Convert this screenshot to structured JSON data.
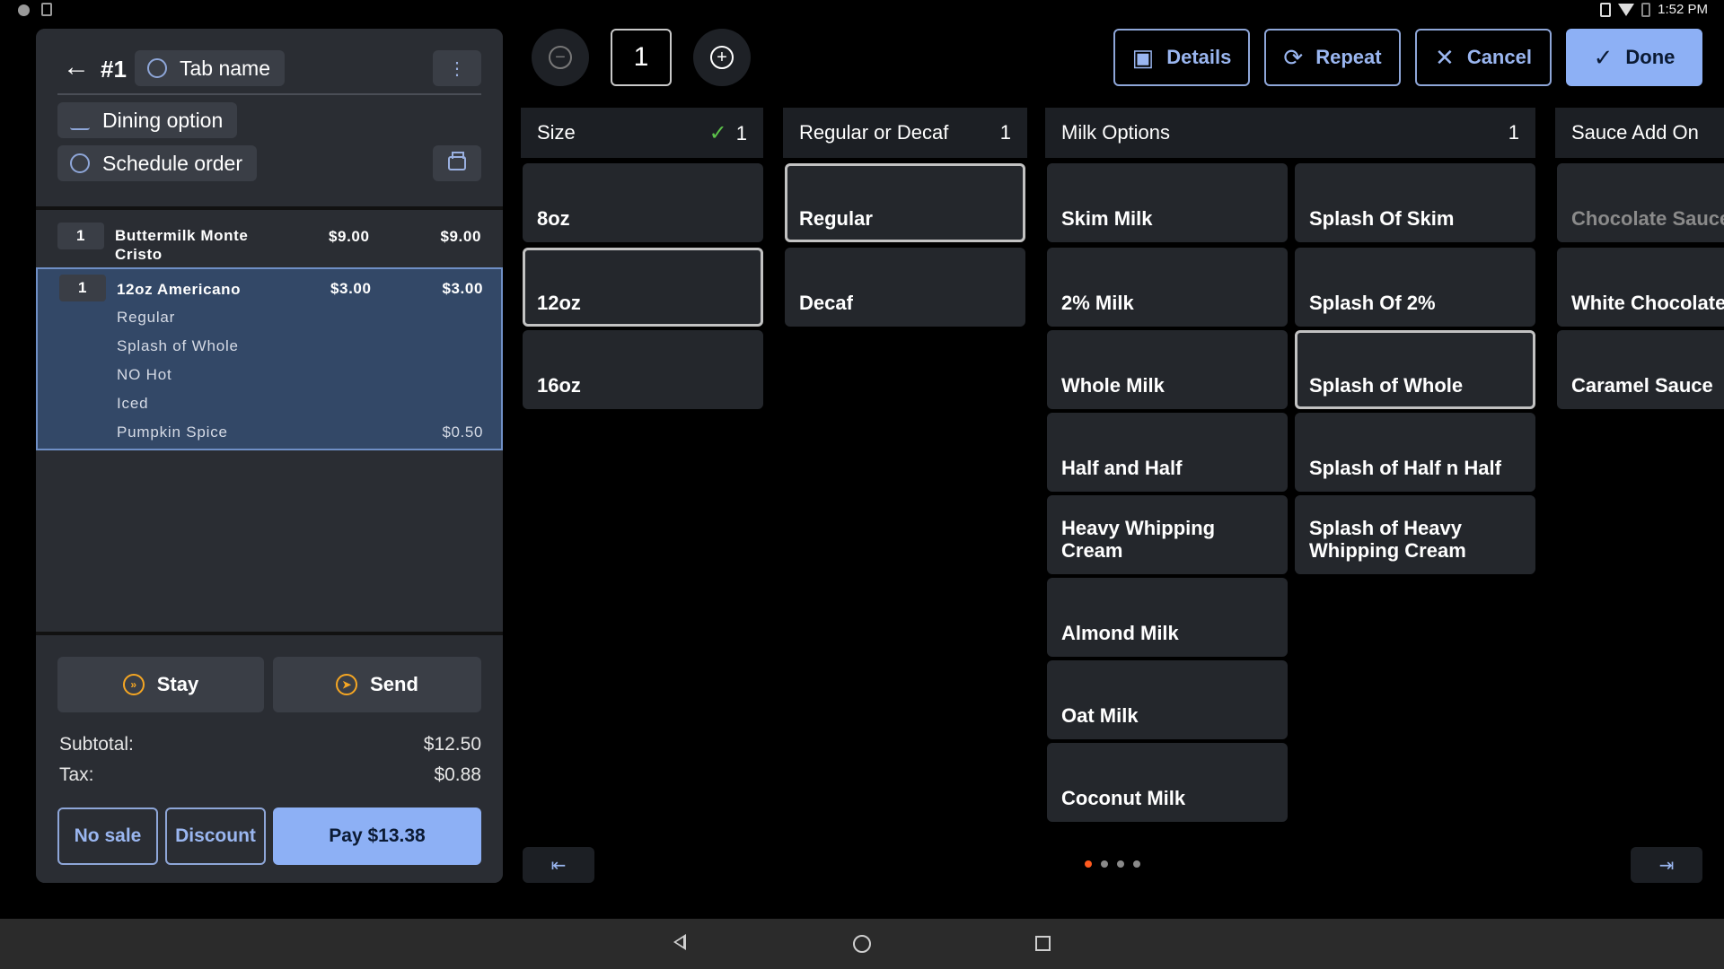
{
  "status_bar": {
    "time": "1:52 PM"
  },
  "order": {
    "number": "#1",
    "tab_name": "Tab name",
    "dining_option": "Dining option",
    "schedule_order": "Schedule order",
    "items": [
      {
        "qty": "1",
        "name": "Buttermilk Monte Cristo",
        "price": "$9.00",
        "total": "$9.00",
        "modifiers": []
      },
      {
        "qty": "1",
        "name": "12oz Americano",
        "price": "$3.00",
        "total": "$3.00",
        "modifiers": [
          {
            "name": "Regular",
            "price": ""
          },
          {
            "name": "Splash of Whole",
            "price": ""
          },
          {
            "name": "NO Hot",
            "price": ""
          },
          {
            "name": "Iced",
            "price": ""
          },
          {
            "name": "Pumpkin Spice",
            "price": "$0.50"
          }
        ]
      }
    ],
    "stay_label": "Stay",
    "send_label": "Send",
    "subtotal_label": "Subtotal:",
    "subtotal": "$12.50",
    "tax_label": "Tax:",
    "tax": "$0.88",
    "no_sale_label": "No sale",
    "discount_label": "Discount",
    "pay_label": "Pay $13.38"
  },
  "toolbar": {
    "quantity": "1",
    "details_label": "Details",
    "repeat_label": "Repeat",
    "cancel_label": "Cancel",
    "done_label": "Done"
  },
  "modifier_groups": [
    {
      "title": "Size",
      "count": "1",
      "satisfied": true,
      "options": [
        "8oz",
        "12oz",
        "16oz"
      ],
      "selected": "12oz"
    },
    {
      "title": "Regular or Decaf",
      "count": "1",
      "options": [
        "Regular",
        "Decaf"
      ],
      "selected": "Regular"
    },
    {
      "title": "Milk Options",
      "count": "1",
      "options": [
        "Skim Milk",
        "Splash Of Skim",
        "2% Milk",
        "Splash Of 2%",
        "Whole Milk",
        "Splash of Whole",
        "Half and Half",
        "Splash of Half n Half",
        "Heavy Whipping Cream",
        "Splash of Heavy Whipping Cream",
        "Almond Milk",
        "Oat Milk",
        "Coconut Milk"
      ],
      "selected": "Splash of Whole"
    },
    {
      "title": "Sauce Add On",
      "options": [
        "Chocolate Sauce",
        "White Chocolate S",
        "Caramel Sauce"
      ]
    }
  ],
  "pagination": {
    "pages": 4,
    "current": 1
  },
  "colors": {
    "accent": "#8db0f5",
    "selected_row": "#334867",
    "check": "#5cc24a",
    "active_dot": "#ff5a1f",
    "stay_send_icon": "#f5a623"
  },
  "icons": [
    "back-arrow-icon",
    "user-icon",
    "dining-icon",
    "clock-icon",
    "kebab-icon",
    "printer-icon",
    "stay-icon",
    "send-icon",
    "minus-icon",
    "plus-icon",
    "details-icon",
    "repeat-icon",
    "close-icon",
    "check-icon"
  ]
}
